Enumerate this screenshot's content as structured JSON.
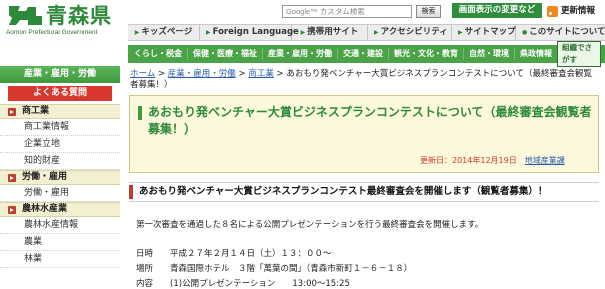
{
  "header": {
    "logo_text": "青森県",
    "logo_sub": "Aomori Prefectural Government",
    "search_placeholder": "Google™ カスタム検索",
    "search_button": "検索",
    "switch_button": "画面表示の変更など",
    "rss_label": "更新情報"
  },
  "topnav": {
    "items": [
      {
        "label": "キッズページ"
      },
      {
        "label": "Foreign Language"
      },
      {
        "label": "携帯用サイト"
      },
      {
        "label": "アクセシビリティ"
      },
      {
        "label": "サイトマップ"
      },
      {
        "label": "このサイトについて"
      }
    ]
  },
  "catnav": {
    "items": [
      {
        "label": "くらし・税金"
      },
      {
        "label": "保健・医療・福祉"
      },
      {
        "label": "産業・雇用・労働"
      },
      {
        "label": "交通・建設"
      },
      {
        "label": "観光・文化・教育"
      },
      {
        "label": "自然・環境"
      },
      {
        "label": "県政情報"
      }
    ],
    "search_label": "組織でさがす"
  },
  "sidebar": {
    "heading": "産業・雇用・労働",
    "faq": "よくある質問",
    "groups": [
      {
        "label": "商工業",
        "items": [
          "商工業情報",
          "企業立地",
          "知的財産"
        ]
      },
      {
        "label": "労働・雇用",
        "items": [
          "労働・雇用"
        ]
      },
      {
        "label": "農林水産業",
        "items": [
          "農林水産情報",
          "農業",
          "林業"
        ]
      }
    ]
  },
  "breadcrumb": {
    "links": [
      "ホーム",
      "産業・雇用・労働",
      "商工業"
    ],
    "separator": " > ",
    "current": "あおもり発ベンチャー大賞ビジネスプランコンテストについて（最終審査会観覧者募集！）"
  },
  "article": {
    "title": "あおもり発ベンチャー大賞ビジネスプランコンテストについて（最終審査会観覧者募集！）",
    "updated": "更新日：2014年12月19日",
    "department": "地域産業課",
    "section_heading": "あおもり発ベンチャー大賞ビジネスプランコンテスト最終審査会を開催します（観覧者募集）！",
    "intro": "第一次審査を通過した８名による公開プレゼンテーションを行う最終審査会を開催します。",
    "details": [
      {
        "label": "日時",
        "value": "平成２７年２月１４日（土）１３：００～"
      },
      {
        "label": "場所",
        "value": "青森国際ホテル　３階「萬葉の間」（青森市新町１－６－１８）"
      },
      {
        "label": "内容",
        "value": "(1)公開プレゼンテーション　　13:00～15:25"
      }
    ]
  }
}
